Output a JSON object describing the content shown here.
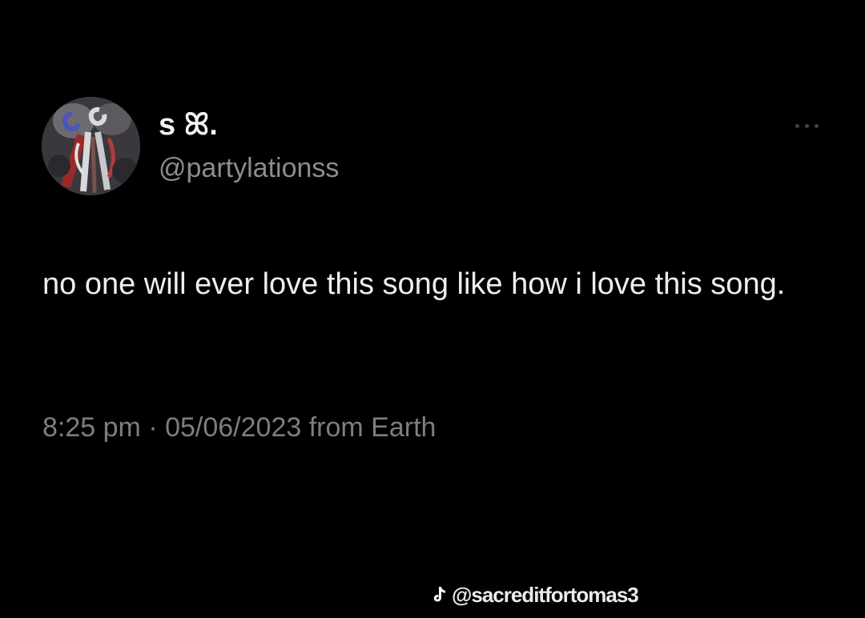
{
  "tweet": {
    "display_name": "s ꕤ.",
    "handle": "@partylationss",
    "text": "no one will ever love this song like how i love this song.",
    "time": "8:25 pm",
    "separator": "·",
    "date": "05/06/2023",
    "source": "from Earth",
    "more_icon": "ellipsis-icon"
  },
  "watermark": {
    "icon": "tiktok-icon",
    "text": "@sacreditfortomas3"
  },
  "colors": {
    "background": "#000000",
    "text_primary": "#eceef0",
    "text_secondary": "#7b7e82"
  }
}
